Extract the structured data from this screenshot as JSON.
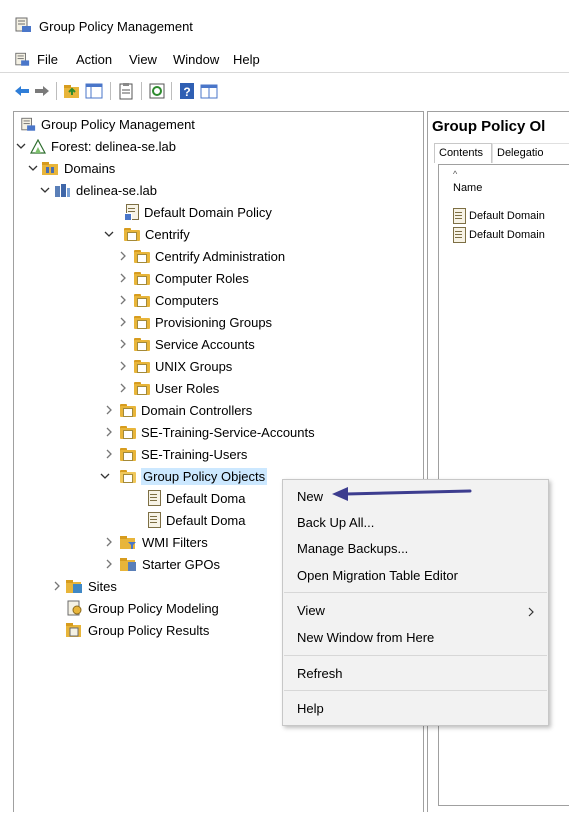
{
  "window": {
    "title": "Group Policy Management",
    "icon": "gpmc-icon"
  },
  "menubar": {
    "items": [
      "File",
      "Action",
      "View",
      "Window",
      "Help"
    ]
  },
  "toolbar": {
    "buttons": [
      "back-icon",
      "forward-icon",
      "up-folder-icon",
      "show-hide-tree-icon",
      "properties-icon",
      "refresh-icon",
      "help-icon",
      "console-icon"
    ]
  },
  "tree": {
    "root": "Group Policy Management",
    "forest": "Forest: delinea-se.lab",
    "domains": "Domains",
    "domain": "delinea-se.lab",
    "default_domain_policy": "Default Domain Policy",
    "centrify": "Centrify",
    "centrify_children": [
      "Centrify Administration",
      "Computer Roles",
      "Computers",
      "Provisioning Groups",
      "Service Accounts",
      "UNIX Groups",
      "User Roles"
    ],
    "domain_controllers": "Domain Controllers",
    "se_training_service_accounts": "SE-Training-Service-Accounts",
    "se_training_users": "SE-Training-Users",
    "group_policy_objects": "Group Policy Objects",
    "gpo_children": [
      "Default Doma",
      "Default Doma"
    ],
    "wmi_filters": "WMI Filters",
    "starter_gpos": "Starter GPOs",
    "sites": "Sites",
    "modeling": "Group Policy Modeling",
    "results": "Group Policy Results"
  },
  "right_pane": {
    "title": "Group Policy Ol",
    "tabs": [
      "Contents",
      "Delegatio"
    ],
    "column_name": "Name",
    "items": [
      "Default Domain",
      "Default Domain"
    ]
  },
  "context_menu": {
    "items": [
      "New",
      "Back Up All...",
      "Manage Backups...",
      "Open Migration Table Editor",
      "View",
      "New Window from Here",
      "Refresh",
      "Help"
    ]
  },
  "annotation": {
    "arrow_color": "#3d3d8f"
  },
  "colors": {
    "selection": "#cce8ff",
    "folder": "#e8b53a",
    "menu_bg": "#f2f2f2"
  }
}
